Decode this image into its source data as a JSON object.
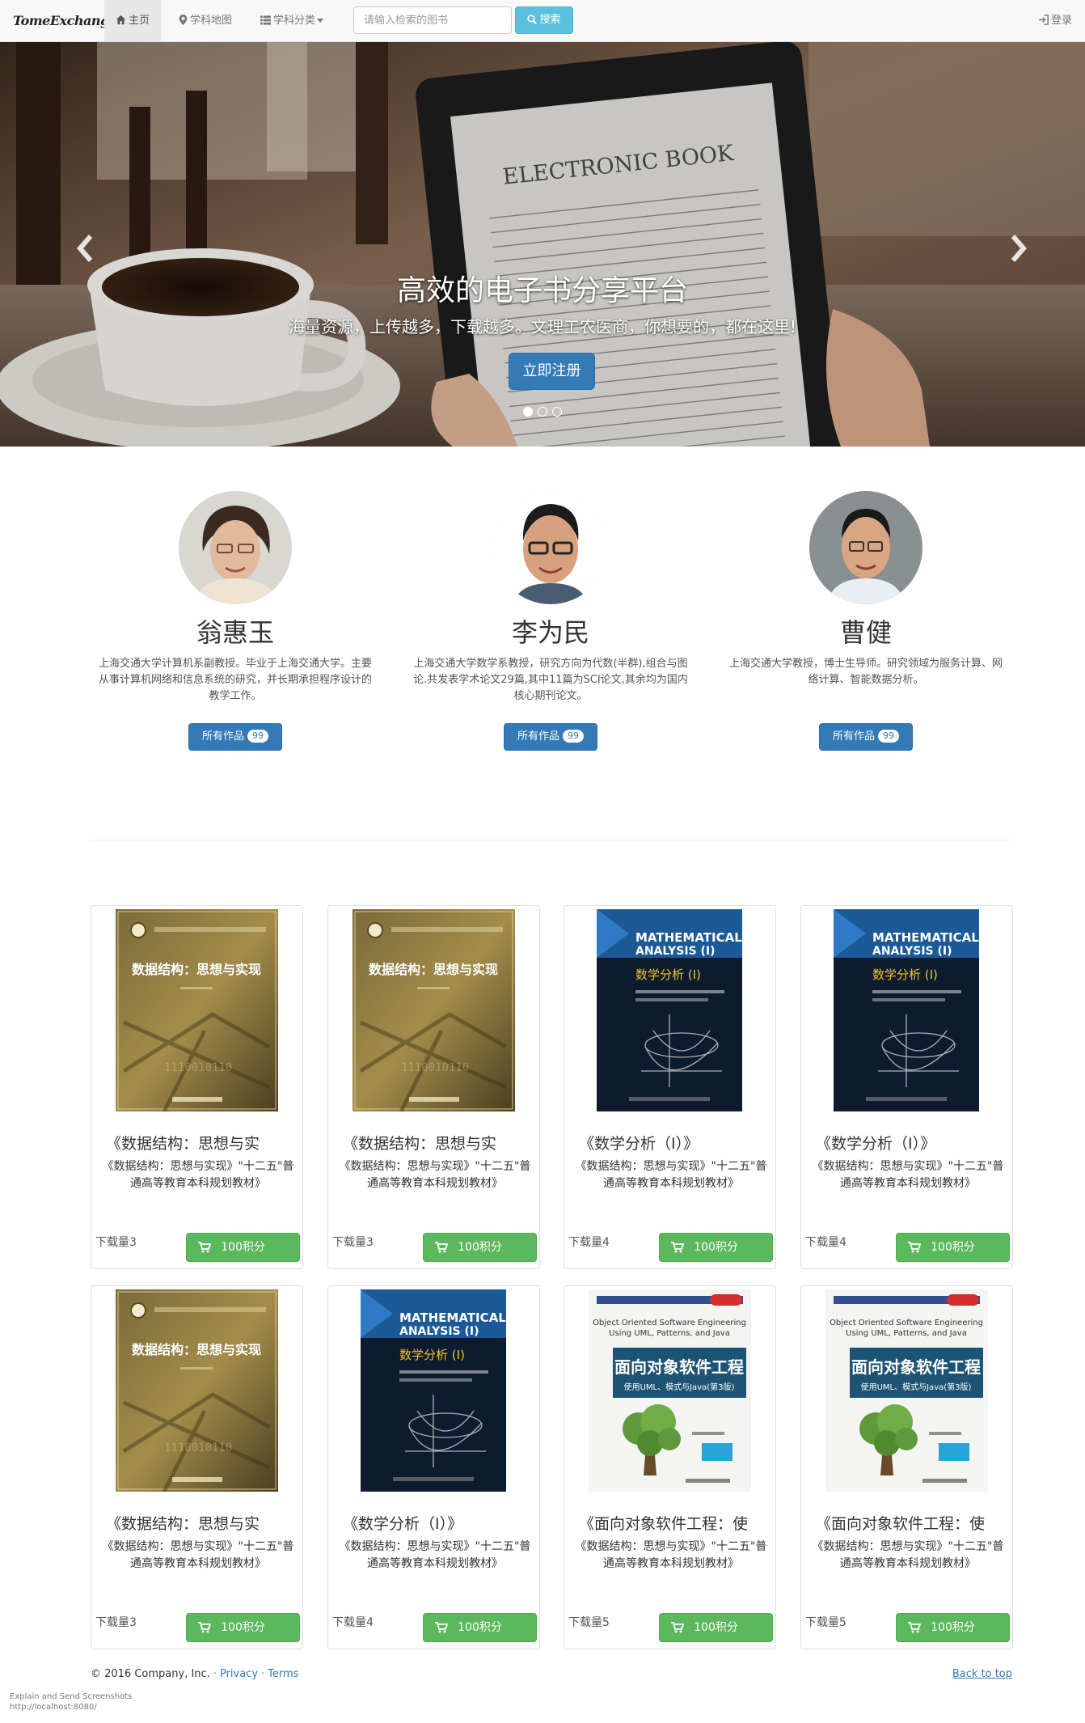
{
  "nav": {
    "brand": "TomeExchange",
    "home": "主页",
    "subject_map": "学科地图",
    "subject_category": "学科分类",
    "search_placeholder": "请输入检索的图书",
    "search_button": "搜索",
    "login": "登录"
  },
  "carousel": {
    "title": "高效的电子书分享平台",
    "subtitle": "海量资源，上传越多，下载越多。文理工农医商，你想要的，都在这里!",
    "register_button": "立即注册",
    "ebook_screen_heading": "ELECTRONIC BOOK"
  },
  "authors": [
    {
      "name": "翁惠玉",
      "description": "上海交通大学计算机系副教授。毕业于上海交通大学。主要从事计算机网络和信息系统的研究，并长期承担程序设计的教学工作。",
      "works_label": "所有作品",
      "works_count": "99"
    },
    {
      "name": "李为民",
      "description": "上海交通大学数学系教授，研究方向为代数(半群),组合与图论.共发表学术论文29篇,其中11篇为SCI论文,其余均为国内核心期刊论文。",
      "works_label": "所有作品",
      "works_count": "99"
    },
    {
      "name": "曹健",
      "description": "上海交通大学教授，博士生导师。研究领域为服务计算、网络计算、智能数据分析。",
      "works_label": "所有作品",
      "works_count": "99"
    }
  ],
  "books": [
    {
      "cover": "ds",
      "title": "《数据结构：思想与实",
      "desc": "《数据结构：思想与实现》\"十二五\"普通高等教育本科规划教材》",
      "downloads": "下载量3",
      "price": "100积分"
    },
    {
      "cover": "ds",
      "title": "《数据结构：思想与实",
      "desc": "《数据结构：思想与实现》\"十二五\"普通高等教育本科规划教材》",
      "downloads": "下载量3",
      "price": "100积分"
    },
    {
      "cover": "ma",
      "title": "《数学分析（Ⅰ）》",
      "desc": "《数据结构：思想与实现》\"十二五\"普通高等教育本科规划教材》",
      "downloads": "下载量4",
      "price": "100积分"
    },
    {
      "cover": "ma",
      "title": "《数学分析（Ⅰ）》",
      "desc": "《数据结构：思想与实现》\"十二五\"普通高等教育本科规划教材》",
      "downloads": "下载量4",
      "price": "100积分"
    },
    {
      "cover": "ds",
      "title": "《数据结构：思想与实",
      "desc": "《数据结构：思想与实现》\"十二五\"普通高等教育本科规划教材》",
      "downloads": "下载量3",
      "price": "100积分"
    },
    {
      "cover": "ma",
      "title": "《数学分析（Ⅰ）》",
      "desc": "《数据结构：思想与实现》\"十二五\"普通高等教育本科规划教材》",
      "downloads": "下载量4",
      "price": "100积分"
    },
    {
      "cover": "oo",
      "title": "《面向对象软件工程：使",
      "desc": "《数据结构：思想与实现》\"十二五\"普通高等教育本科规划教材》",
      "downloads": "下载量5",
      "price": "100积分"
    },
    {
      "cover": "oo",
      "title": "《面向对象软件工程：使",
      "desc": "《数据结构：思想与实现》\"十二五\"普通高等教育本科规划教材》",
      "downloads": "下载量5",
      "price": "100积分"
    }
  ],
  "covers": {
    "ds": {
      "title": "数据结构：思想与实现"
    },
    "ma": {
      "title_en_1": "MATHEMATICAL",
      "title_en_2": "ANALYSIS (I)",
      "title_cn": "数学分析 (I)"
    },
    "oo": {
      "title_en_1": "Object Oriented Software Engineering",
      "title_en_2": "Using UML, Patterns, and Java",
      "title_cn": "面向对象软件工程",
      "subtitle_cn": "使用UML、模式与Java(第3版)"
    }
  },
  "footer": {
    "copyright": "© 2016 Company, Inc.",
    "privacy": "Privacy",
    "terms": "Terms",
    "back_to_top": "Back to top"
  },
  "status_bar": {
    "line1": "Explain and Send Screenshots",
    "line2": "http://localhost:8080/"
  },
  "colors": {
    "primary": "#337ab7",
    "info": "#5bc0de",
    "success": "#5cb85c"
  }
}
